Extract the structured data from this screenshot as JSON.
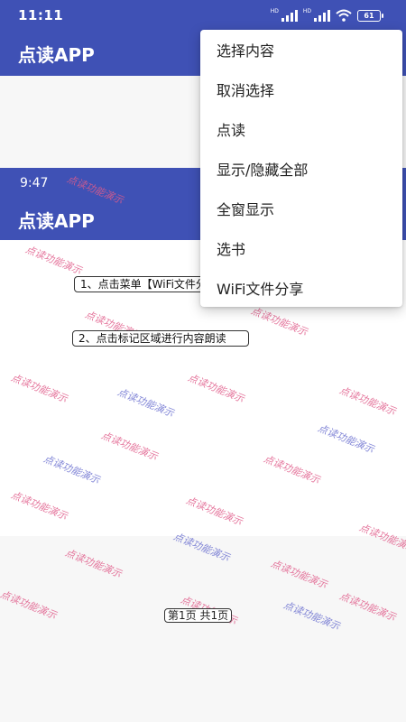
{
  "status_bar": {
    "time": "11:11",
    "battery": "61",
    "signal_tag": "HD"
  },
  "app_bar": {
    "title": "点读APP"
  },
  "inner_screen": {
    "time": "9:47",
    "title": "点读APP",
    "regions": [
      "1、点击菜单【WiFi文件分享】",
      "2、点击标记区域进行内容朗读"
    ],
    "page_indicator": "第1页 共1页",
    "watermark": "点读功能演示"
  },
  "menu": {
    "items": [
      {
        "label": "选择内容"
      },
      {
        "label": "取消选择"
      },
      {
        "label": "点读"
      },
      {
        "label": "显示/隐藏全部"
      },
      {
        "label": "全窗显示"
      },
      {
        "label": "选书"
      },
      {
        "label": "WiFi文件分享"
      }
    ]
  },
  "colors": {
    "primary": "#3f51b5",
    "watermark_pink": "#e05c8a",
    "watermark_blue": "#6a6fcf"
  }
}
